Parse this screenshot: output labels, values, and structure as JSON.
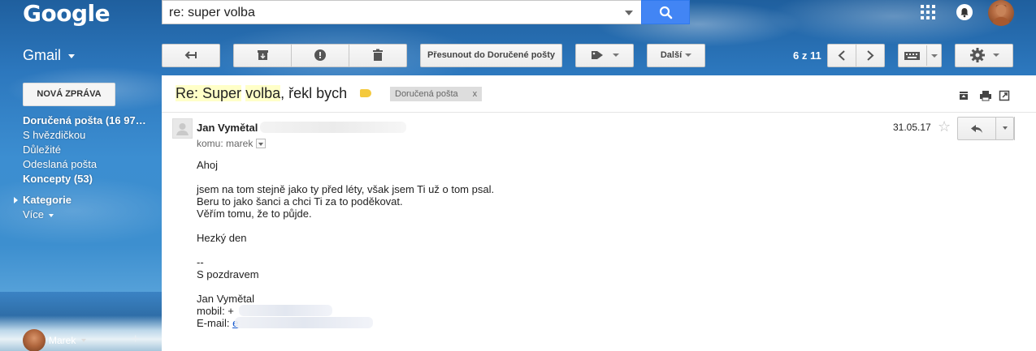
{
  "header": {
    "logo": "Google",
    "search_value": "re: super volba",
    "app_name": "Gmail"
  },
  "toolbar": {
    "move_label": "Přesunout do Doručené pošty",
    "more_label": "Další",
    "pager": "6 z 11"
  },
  "sidebar": {
    "compose_label": "NOVÁ ZPRÁVA",
    "items": [
      {
        "label": "Doručená pošta (16 97…",
        "bold": true
      },
      {
        "label": "S hvězdičkou",
        "bold": false
      },
      {
        "label": "Důležité",
        "bold": false
      },
      {
        "label": "Odeslaná pošta",
        "bold": false
      },
      {
        "label": "Koncepty (53)",
        "bold": true
      }
    ],
    "category_label": "Kategorie",
    "more_label": "Více",
    "user_name": "Marek"
  },
  "message": {
    "subject_highlight_1": "Re: Super",
    "subject_mid": " ",
    "subject_highlight_2": "volba",
    "subject_rest": ", řekl bych",
    "chip_label": "Doručená pošta",
    "chip_close": "x",
    "sender_name": "Jan Vymětal",
    "to_line": "komu: marek",
    "date": "31.05.17",
    "body_lines": [
      "Ahoj",
      "",
      "jsem na tom stejně jako ty před léty, však jsem Ti už o tom psal.",
      "Beru to jako šanci a chci Ti za to poděkovat.",
      "Věřím tomu, že to půjde.",
      "",
      "Hezký den",
      "",
      "--",
      "S pozdravem",
      "",
      "Jan Vymětal"
    ],
    "mobile_label": "mobil: +",
    "email_label": "E-mail: ",
    "email_link_char": "e"
  },
  "colors": {
    "accent": "#4285f4",
    "subject_highlight": "#ffffc8",
    "label_tag": "#f4c93d"
  }
}
